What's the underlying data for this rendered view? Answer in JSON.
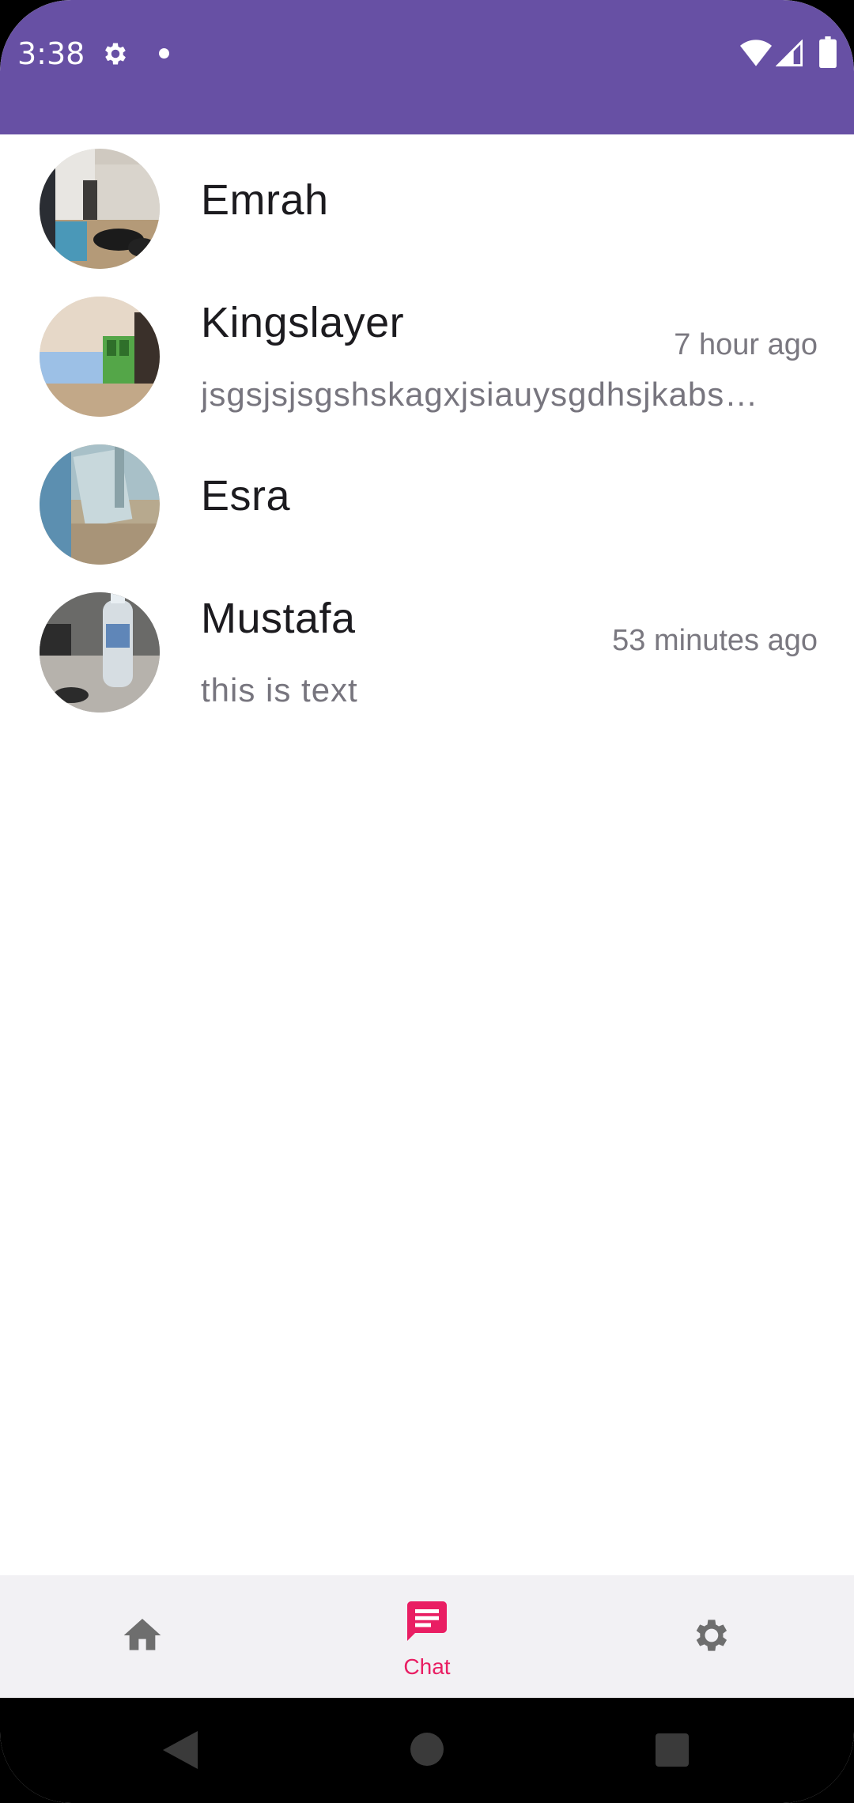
{
  "status_bar": {
    "time": "3:38",
    "icons": [
      "settings-icon",
      "notification-dot",
      "wifi-icon",
      "signal-icon",
      "battery-icon"
    ],
    "background": "#6750A4"
  },
  "chats": [
    {
      "name": "Emrah",
      "time": "",
      "preview": "",
      "avatar": "photo-room-sunglasses"
    },
    {
      "name": "Kingslayer",
      "time": "7 hour ago",
      "preview": "jsgsjsjsgshskagxjsiauysgdhsjkabsjsjsj",
      "avatar": "photo-room-shelf"
    },
    {
      "name": "Esra",
      "time": "",
      "preview": "",
      "avatar": "photo-blurry-floor"
    },
    {
      "name": "Mustafa",
      "time": "53 minutes ago",
      "preview": "this is text",
      "avatar": "photo-water-bottle"
    }
  ],
  "bottom_nav": {
    "items": [
      {
        "id": "home",
        "label": "",
        "icon": "home-icon",
        "active": false
      },
      {
        "id": "chat",
        "label": "Chat",
        "icon": "chat-icon",
        "active": true
      },
      {
        "id": "settings",
        "label": "",
        "icon": "settings-icon",
        "active": false
      }
    ],
    "active_color": "#E91E63",
    "inactive_color": "#6E6E6E"
  },
  "system_nav": {
    "buttons": [
      "back-icon",
      "home-circle-icon",
      "recents-icon"
    ]
  }
}
